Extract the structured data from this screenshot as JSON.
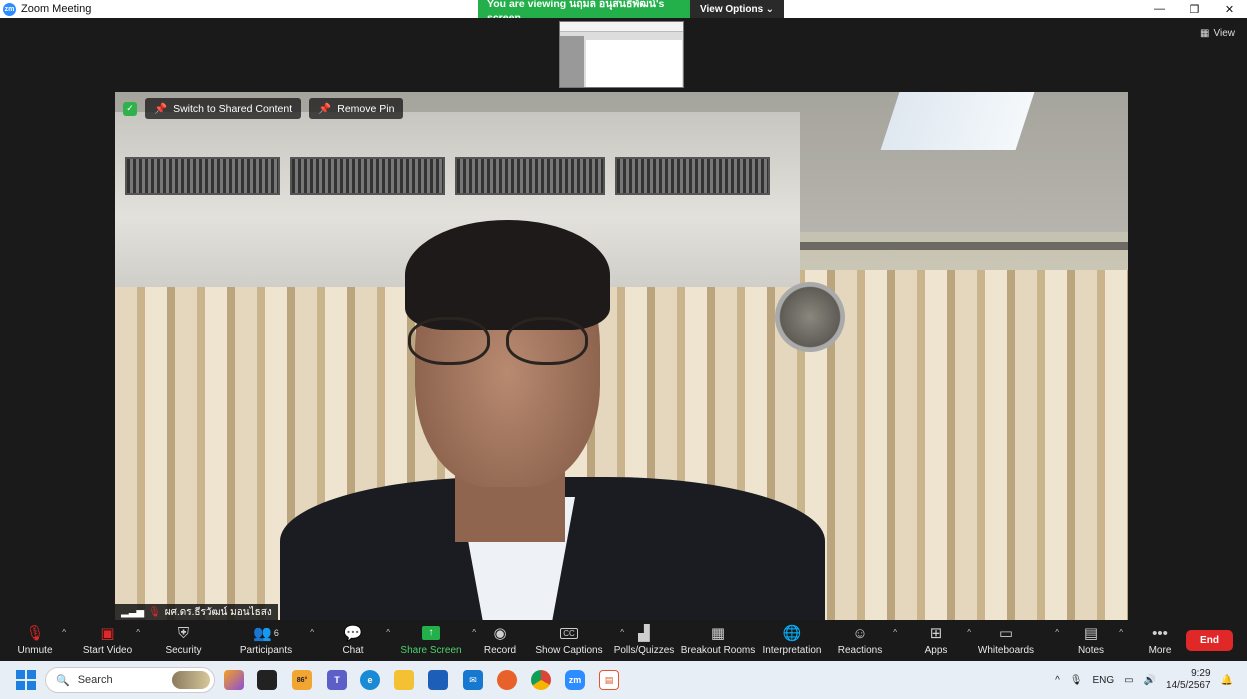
{
  "window": {
    "title": "Zoom Meeting",
    "controls": {
      "minimize": "—",
      "restore": "❐",
      "close": "✕"
    }
  },
  "banner": {
    "viewing_text": "You are viewing นฤมล อนุสนธิ์พัฒน์'s screen",
    "view_options_label": "View Options"
  },
  "stage": {
    "view_label": "View"
  },
  "video_controls": {
    "switch_label": "Switch to Shared Content",
    "remove_pin_label": "Remove Pin"
  },
  "participant_name": "ผศ.ดร.ธีรวัฒน์ มอนไธสง",
  "toolbar": {
    "items": [
      {
        "label": "Unmute"
      },
      {
        "label": "Start Video"
      },
      {
        "label": "Security"
      },
      {
        "label": "Participants",
        "count": "6"
      },
      {
        "label": "Chat"
      },
      {
        "label": "Share Screen"
      },
      {
        "label": "Record"
      },
      {
        "label": "Show Captions"
      },
      {
        "label": "Polls/Quizzes"
      },
      {
        "label": "Breakout Rooms"
      },
      {
        "label": "Interpretation"
      },
      {
        "label": "Reactions"
      },
      {
        "label": "Apps"
      },
      {
        "label": "Whiteboards"
      },
      {
        "label": "Notes"
      },
      {
        "label": "More"
      }
    ],
    "end_label": "End"
  },
  "taskbar": {
    "search_placeholder": "Search",
    "weather_temp": "86°",
    "language": "ENG",
    "time": "9:29",
    "date": "14/5/2567"
  },
  "colors": {
    "share_green": "#23b04a",
    "end_red": "#e02828",
    "zoom_blue": "#2d8cff"
  }
}
